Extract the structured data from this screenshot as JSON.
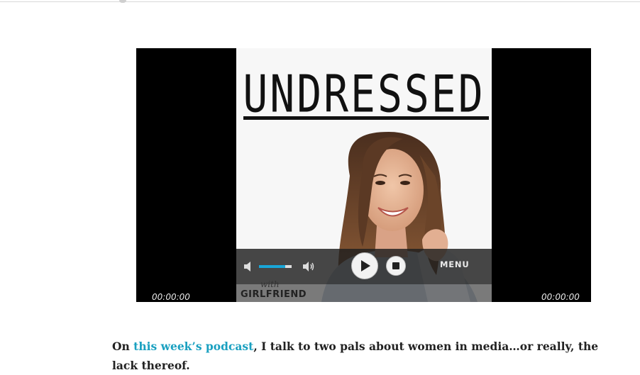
{
  "poster": {
    "title": "UNDRESSED",
    "bottom_text": "GIRLFRIEND",
    "script_text": "with"
  },
  "player": {
    "time_current": "00:00:00",
    "time_total": "00:00:00",
    "menu_label": "MENU",
    "volume_level": 0.8,
    "accent_color": "#19a6d8"
  },
  "article": {
    "prefix": "On ",
    "link_text": "this week’s podcast",
    "suffix": ", I talk to two pals about women in media…or really, the lack thereof.",
    "link_color": "#1aa0c0"
  }
}
